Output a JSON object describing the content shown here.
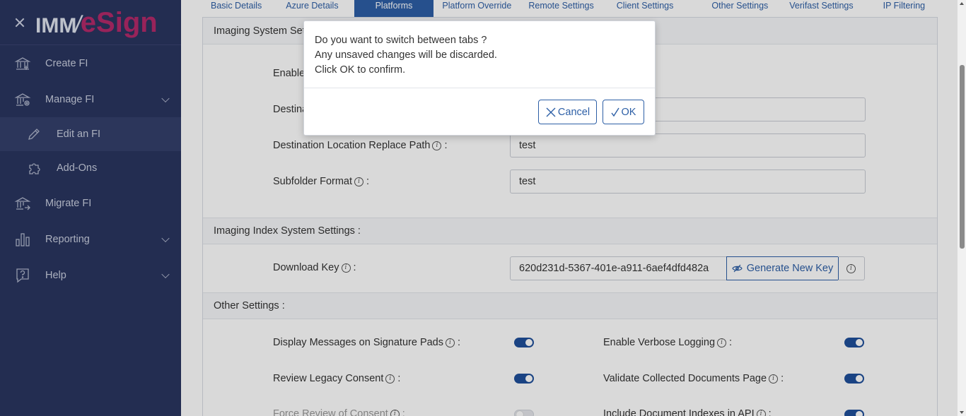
{
  "sidebar": {
    "logo": {
      "imm": "IMM",
      "slash": "/",
      "esign": "eSign"
    },
    "items": [
      {
        "label": "Create FI",
        "icon": "bank-icon"
      },
      {
        "label": "Manage FI",
        "icon": "bank-gear-icon"
      },
      {
        "label": "Edit an FI",
        "icon": "pencil-icon"
      },
      {
        "label": "Add-Ons",
        "icon": "puzzle-icon"
      },
      {
        "label": "Migrate FI",
        "icon": "bank-arrow-icon"
      },
      {
        "label": "Reporting",
        "icon": "bar-chart-icon"
      },
      {
        "label": "Help",
        "icon": "help-icon"
      }
    ]
  },
  "tabs": [
    "Basic Details",
    "Azure Details",
    "Platforms",
    "Platform Override",
    "Remote Settings",
    "Client Settings",
    "Other Settings",
    "Verifast Settings",
    "IP Filtering"
  ],
  "active_tab": "Platforms",
  "imaging": {
    "header": "Imaging System Set",
    "enable_label": "Enable",
    "dest_label": "Destina",
    "replace_label": "Destination Location Replace Path",
    "replace_value": "test",
    "subfolder_label": "Subfolder Format",
    "subfolder_value": "test",
    "colon": ":"
  },
  "index": {
    "header": "Imaging Index System Settings :",
    "download_label": "Download Key",
    "download_value": "620d231d-5367-401e-a911-6aef4dfd482a",
    "generate_label": "Generate New Key"
  },
  "other": {
    "header": "Other Settings :",
    "display_messages": "Display Messages on Signature Pads",
    "verbose_logging": "Enable Verbose Logging",
    "review_legacy": "Review Legacy Consent",
    "validate_collected": "Validate Collected Documents Page",
    "force_review": "Force Review of Consent",
    "include_indexes": "Include Document Indexes in API"
  },
  "info_glyph": "i",
  "modal": {
    "line1": "Do you want to switch between tabs ?",
    "line2": "Any unsaved changes will be discarded.",
    "line3": "Click OK to confirm.",
    "cancel": "Cancel",
    "ok": "OK"
  },
  "colors": {
    "sidebar": "#2a3560",
    "accent": "#2d5fa6",
    "brand": "#b32a6a"
  }
}
